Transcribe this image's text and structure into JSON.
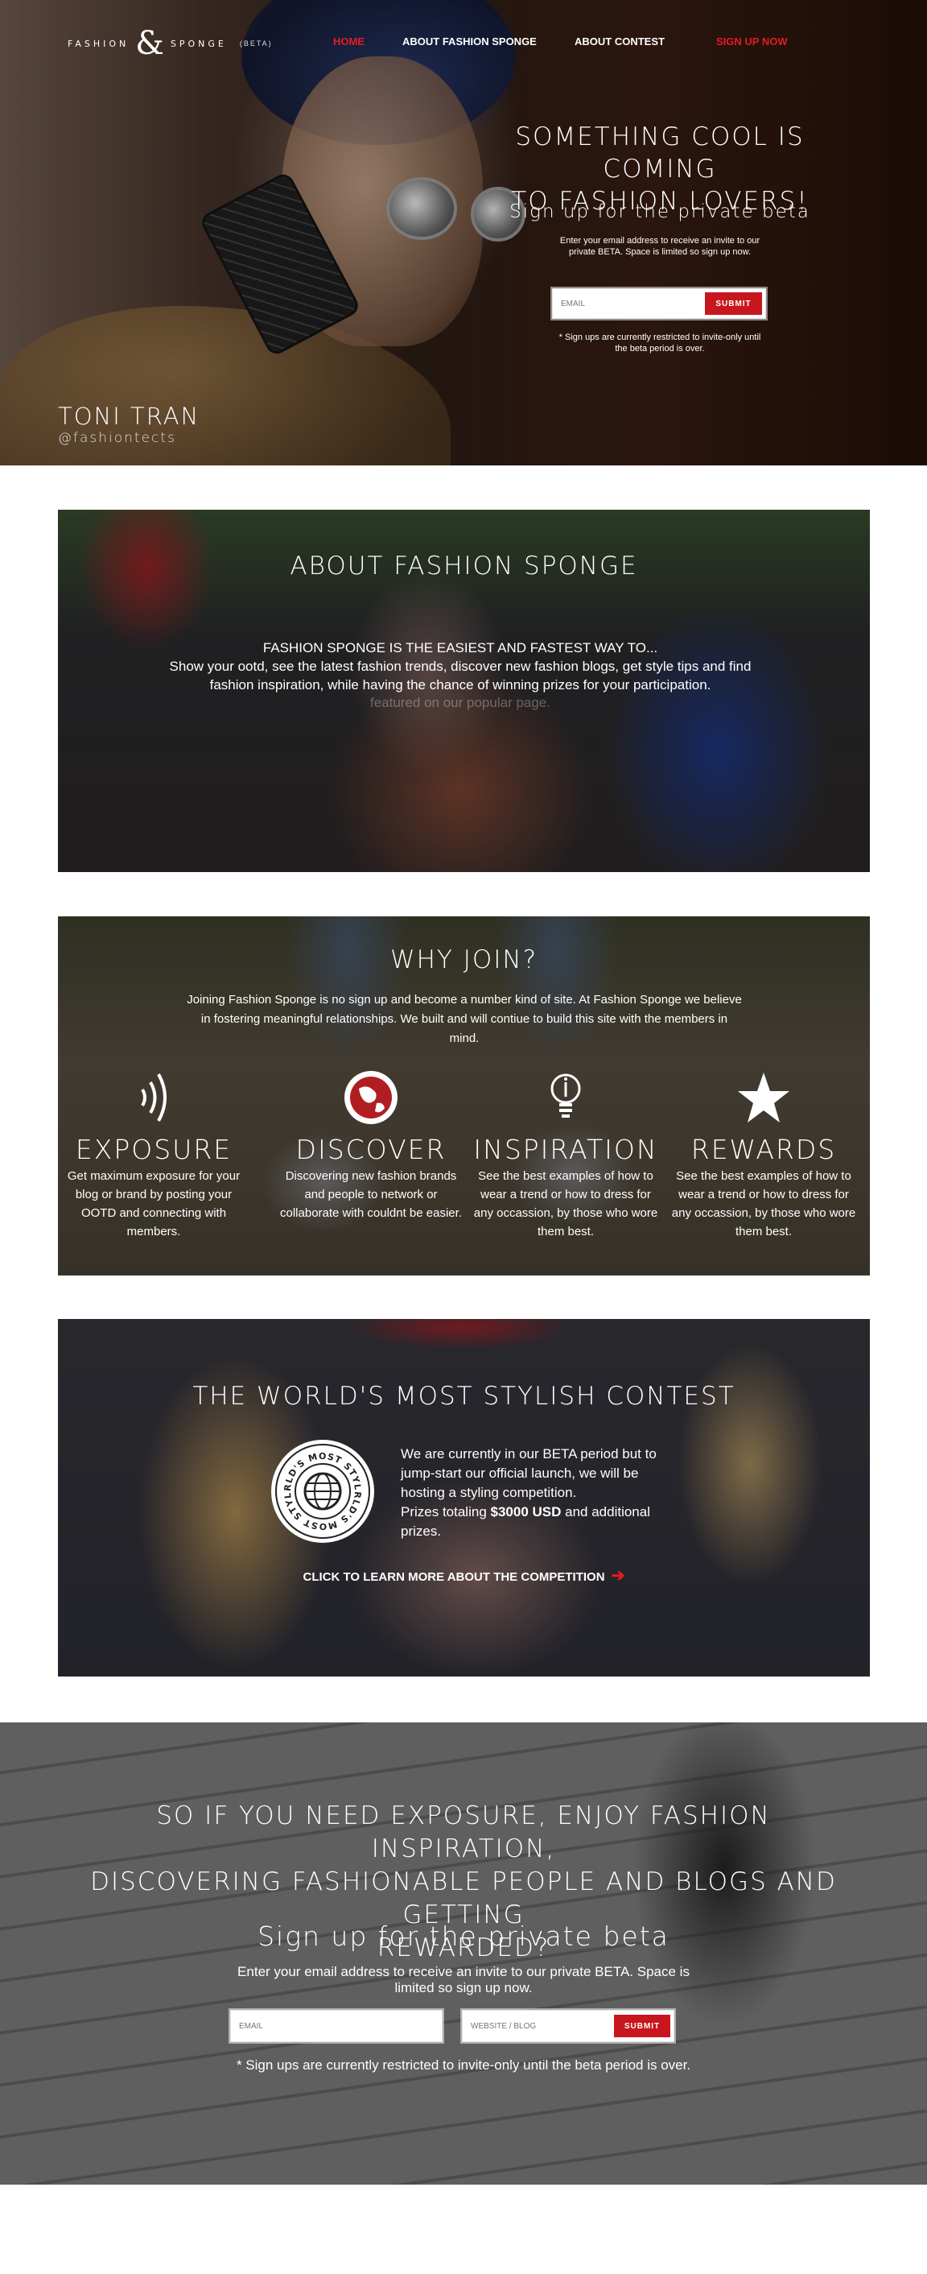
{
  "header": {
    "logo": {
      "word_left": "FASHION",
      "ampersand": "&",
      "word_right": "SPONGE",
      "beta": "(BETA)"
    },
    "nav": [
      {
        "label": "HOME",
        "color": "#e21b23"
      },
      {
        "label": "ABOUT FASHION SPONGE"
      },
      {
        "label": "ABOUT CONTEST"
      },
      {
        "label": "SIGN UP NOW",
        "color": "#e21b23"
      }
    ]
  },
  "hero": {
    "title_line1": "SOMETHING COOL IS COMING",
    "title_line2": "TO FASHION LOVERS!",
    "subtitle": "Sign up for the private beta",
    "description": "Enter your email address to receive an invite to our private BETA. Space is limited so sign up now.",
    "email_placeholder": "EMAIL",
    "submit_label": "SUBMIT",
    "note": "* Sign ups are currently restricted to invite-only until the beta period is over.",
    "credit_name": "TONI TRAN",
    "credit_handle": "@fashiontects"
  },
  "about": {
    "title": "ABOUT FASHION SPONGE",
    "text_line1": "FASHION SPONGE IS THE EASIEST AND FASTEST WAY TO...",
    "text_line2": "Show your ootd, see the latest fashion trends, discover new fashion blogs, get style tips and find fashion inspiration, while having the chance of winning prizes for your participation.",
    "text_fade": "featured on our popular page."
  },
  "why_join": {
    "title": "WHY JOIN?",
    "text": "Joining Fashion Sponge is no sign up and become a number kind of site. At Fashion Sponge we believe in fostering meaningful relationships. We built and will contiue to build this site with the members in mind.",
    "features": [
      {
        "name": "EXPOSURE",
        "icon": "broadcast-icon",
        "desc": "Get maximum exposure for your blog or brand by posting your OOTD and connecting with members."
      },
      {
        "name": "DISCOVER",
        "icon": "globe-icon",
        "desc": "Discovering new fashion brands and people to network or collaborate with couldnt be easier."
      },
      {
        "name": "INSPIRATION",
        "icon": "lightbulb-icon",
        "desc": "See the best examples of how to wear a trend or how to dress for any occassion, by those who wore them best."
      },
      {
        "name": "REWARDS",
        "icon": "star-icon",
        "desc": "See the best examples of how to wear a trend or how to dress for any occassion, by those who wore them best."
      }
    ]
  },
  "contest": {
    "title": "THE WORLD'S MOST STYLISH CONTEST",
    "badge_text": "WORLD'S MOST STYLISH",
    "text": "We are currently in our BETA period but to jump-start our official launch, we will be hosting a styling competition.",
    "prize_prefix": "Prizes totaling ",
    "prize_amount": "$3000 USD",
    "prize_suffix": " and additional prizes.",
    "link_label": "CLICK TO LEARN MORE ABOUT THE COMPETITION",
    "link_arrow": "➔"
  },
  "bottom": {
    "title_line1": "SO IF YOU NEED EXPOSURE, ENJOY FASHION INSPIRATION,",
    "title_line2": "DISCOVERING FASHIONABLE PEOPLE AND BLOGS AND GETTING",
    "title_line3": "REWARDED?",
    "subtitle": "Sign up for the private beta",
    "description": "Enter your email address to receive an invite to our private BETA. Space is limited so sign up now.",
    "email_placeholder": "EMAIL",
    "website_placeholder": "WEBSITE / BLOG",
    "submit_label": "SUBMIT",
    "note": "* Sign ups are currently restricted to invite-only until the beta period is over."
  },
  "colors": {
    "accent": "#e21b23",
    "button": "#c8161e"
  }
}
